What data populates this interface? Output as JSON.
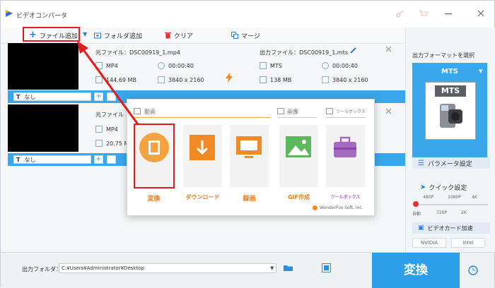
{
  "app": {
    "title": "ビデオコンバータ"
  },
  "toolbar": {
    "add_file": "ファイル追加",
    "add_folder": "フォルダ追加",
    "clear": "クリア",
    "merge": "マージ"
  },
  "files": [
    {
      "source_label": "元ファイル：DSC00919_1.mp4",
      "output_label": "出力ファイル：DSC00919_1.mts",
      "src_format": "MP4",
      "src_duration": "00:00:40",
      "src_size": "144.69 MB",
      "src_resolution": "3840 x 2160",
      "out_format": "MTS",
      "out_duration": "00:00:40",
      "out_size": "138 MB",
      "out_resolution": "3840 x 2160",
      "subtitle": "なし"
    },
    {
      "source_label": "元ファイル",
      "src_format": "MP4",
      "src_size": "20.75 M",
      "subtitle": "なし"
    }
  ],
  "popup": {
    "sections": {
      "video": "動画",
      "image": "画像",
      "toolbox": "ツールボックス"
    },
    "tiles": [
      {
        "label": "変換",
        "icon": "film-icon"
      },
      {
        "label": "ダウンロード",
        "icon": "download-icon"
      },
      {
        "label": "録画",
        "icon": "screen-record-icon"
      },
      {
        "label": "GIF作成",
        "icon": "image-icon"
      },
      {
        "label": "ツールボックス",
        "icon": "toolbox-icon"
      }
    ],
    "footer": "WonderFox Soft, Inc."
  },
  "right_panel": {
    "format_title": "出力フォーマットを選択",
    "format_value": "MTS",
    "format_icon_text": "MTS",
    "param_button": "パラメータ設定",
    "quick_title": "クイック設定",
    "quick_top_labels": [
      "480P",
      "1080P",
      "4K"
    ],
    "quick_bottom_labels": [
      "自動",
      "720P",
      "2K"
    ],
    "gpu_title": "ビデオカード加速",
    "gpu_vendors": [
      "NVIDIA",
      "Intel"
    ]
  },
  "bottom": {
    "output_folder_label": "出力フォルダ：",
    "output_folder_path": "C:¥Users¥Administrator¥Desktop",
    "convert_button": "変換"
  },
  "colors": {
    "accent": "#3aa7ea",
    "orange": "#e67e22",
    "highlight": "#e01c1c"
  }
}
